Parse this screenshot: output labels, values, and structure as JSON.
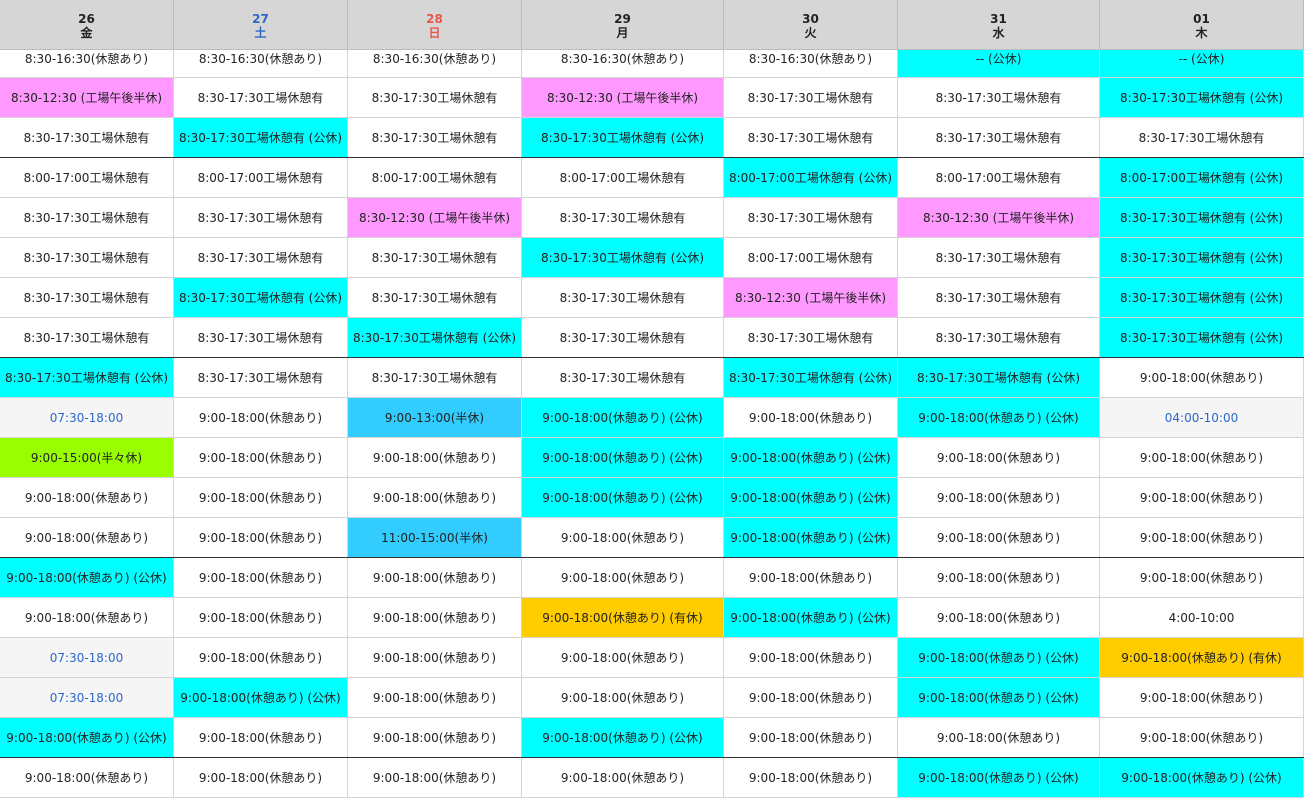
{
  "days": [
    {
      "date": "26",
      "weekday": "金",
      "type": "normal"
    },
    {
      "date": "27",
      "weekday": "土",
      "type": "sat"
    },
    {
      "date": "28",
      "weekday": "日",
      "type": "sun"
    },
    {
      "date": "29",
      "weekday": "月",
      "type": "normal"
    },
    {
      "date": "30",
      "weekday": "火",
      "type": "normal"
    },
    {
      "date": "31",
      "weekday": "水",
      "type": "normal"
    },
    {
      "date": "01",
      "weekday": "木",
      "type": "normal"
    }
  ],
  "legend_colors": {
    "w": "#ffffff",
    "c": "#00ffff",
    "p": "#ff99ff",
    "b": "#33ccff",
    "g": "#99ff00",
    "o": "#ffcc00",
    "e": "#f5f5f5"
  },
  "rows": [
    [
      [
        "8:30-16:30(休憩あり)",
        "w"
      ],
      [
        "8:30-16:30(休憩あり)",
        "w"
      ],
      [
        "8:30-16:30(休憩あり)",
        "w"
      ],
      [
        "8:30-16:30(休憩あり)",
        "w"
      ],
      [
        "8:30-16:30(休憩あり)",
        "w"
      ],
      [
        "-- (公休)",
        "c"
      ],
      [
        "-- (公休)",
        "c"
      ]
    ],
    [
      [
        "8:30-12:30 (工場午後半休)",
        "p"
      ],
      [
        "8:30-17:30工場休憩有",
        "w"
      ],
      [
        "8:30-17:30工場休憩有",
        "w"
      ],
      [
        "8:30-12:30 (工場午後半休)",
        "p"
      ],
      [
        "8:30-17:30工場休憩有",
        "w"
      ],
      [
        "8:30-17:30工場休憩有",
        "w"
      ],
      [
        "8:30-17:30工場休憩有 (公休)",
        "c"
      ]
    ],
    [
      [
        "8:30-17:30工場休憩有",
        "w"
      ],
      [
        "8:30-17:30工場休憩有 (公休)",
        "c"
      ],
      [
        "8:30-17:30工場休憩有",
        "w"
      ],
      [
        "8:30-17:30工場休憩有 (公休)",
        "c"
      ],
      [
        "8:30-17:30工場休憩有",
        "w"
      ],
      [
        "8:30-17:30工場休憩有",
        "w"
      ],
      [
        "8:30-17:30工場休憩有",
        "w"
      ]
    ],
    [
      [
        "8:00-17:00工場休憩有",
        "w"
      ],
      [
        "8:00-17:00工場休憩有",
        "w"
      ],
      [
        "8:00-17:00工場休憩有",
        "w"
      ],
      [
        "8:00-17:00工場休憩有",
        "w"
      ],
      [
        "8:00-17:00工場休憩有 (公休)",
        "c"
      ],
      [
        "8:00-17:00工場休憩有",
        "w"
      ],
      [
        "8:00-17:00工場休憩有 (公休)",
        "c"
      ]
    ],
    [
      [
        "8:30-17:30工場休憩有",
        "w"
      ],
      [
        "8:30-17:30工場休憩有",
        "w"
      ],
      [
        "8:30-12:30 (工場午後半休)",
        "p"
      ],
      [
        "8:30-17:30工場休憩有",
        "w"
      ],
      [
        "8:30-17:30工場休憩有",
        "w"
      ],
      [
        "8:30-12:30 (工場午後半休)",
        "p"
      ],
      [
        "8:30-17:30工場休憩有 (公休)",
        "c"
      ]
    ],
    [
      [
        "8:30-17:30工場休憩有",
        "w"
      ],
      [
        "8:30-17:30工場休憩有",
        "w"
      ],
      [
        "8:30-17:30工場休憩有",
        "w"
      ],
      [
        "8:30-17:30工場休憩有 (公休)",
        "c"
      ],
      [
        "8:00-17:00工場休憩有",
        "w"
      ],
      [
        "8:30-17:30工場休憩有",
        "w"
      ],
      [
        "8:30-17:30工場休憩有 (公休)",
        "c"
      ]
    ],
    [
      [
        "8:30-17:30工場休憩有",
        "w"
      ],
      [
        "8:30-17:30工場休憩有 (公休)",
        "c"
      ],
      [
        "8:30-17:30工場休憩有",
        "w"
      ],
      [
        "8:30-17:30工場休憩有",
        "w"
      ],
      [
        "8:30-12:30 (工場午後半休)",
        "p"
      ],
      [
        "8:30-17:30工場休憩有",
        "w"
      ],
      [
        "8:30-17:30工場休憩有 (公休)",
        "c"
      ]
    ],
    [
      [
        "8:30-17:30工場休憩有",
        "w"
      ],
      [
        "8:30-17:30工場休憩有",
        "w"
      ],
      [
        "8:30-17:30工場休憩有 (公休)",
        "c"
      ],
      [
        "8:30-17:30工場休憩有",
        "w"
      ],
      [
        "8:30-17:30工場休憩有",
        "w"
      ],
      [
        "8:30-17:30工場休憩有",
        "w"
      ],
      [
        "8:30-17:30工場休憩有 (公休)",
        "c"
      ]
    ],
    [
      [
        "8:30-17:30工場休憩有 (公休)",
        "c"
      ],
      [
        "8:30-17:30工場休憩有",
        "w"
      ],
      [
        "8:30-17:30工場休憩有",
        "w"
      ],
      [
        "8:30-17:30工場休憩有",
        "w"
      ],
      [
        "8:30-17:30工場休憩有 (公休)",
        "c"
      ],
      [
        "8:30-17:30工場休憩有 (公休)",
        "c"
      ],
      [
        "9:00-18:00(休憩あり)",
        "w"
      ]
    ],
    [
      [
        "07:30-18:00",
        "e"
      ],
      [
        "9:00-18:00(休憩あり)",
        "w"
      ],
      [
        "9:00-13:00(半休)",
        "b"
      ],
      [
        "9:00-18:00(休憩あり) (公休)",
        "c"
      ],
      [
        "9:00-18:00(休憩あり)",
        "w"
      ],
      [
        "9:00-18:00(休憩あり) (公休)",
        "c"
      ],
      [
        "04:00-10:00",
        "e"
      ]
    ],
    [
      [
        "9:00-15:00(半々休)",
        "g"
      ],
      [
        "9:00-18:00(休憩あり)",
        "w"
      ],
      [
        "9:00-18:00(休憩あり)",
        "w"
      ],
      [
        "9:00-18:00(休憩あり) (公休)",
        "c"
      ],
      [
        "9:00-18:00(休憩あり) (公休)",
        "c"
      ],
      [
        "9:00-18:00(休憩あり)",
        "w"
      ],
      [
        "9:00-18:00(休憩あり)",
        "w"
      ]
    ],
    [
      [
        "9:00-18:00(休憩あり)",
        "w"
      ],
      [
        "9:00-18:00(休憩あり)",
        "w"
      ],
      [
        "9:00-18:00(休憩あり)",
        "w"
      ],
      [
        "9:00-18:00(休憩あり) (公休)",
        "c"
      ],
      [
        "9:00-18:00(休憩あり) (公休)",
        "c"
      ],
      [
        "9:00-18:00(休憩あり)",
        "w"
      ],
      [
        "9:00-18:00(休憩あり)",
        "w"
      ]
    ],
    [
      [
        "9:00-18:00(休憩あり)",
        "w"
      ],
      [
        "9:00-18:00(休憩あり)",
        "w"
      ],
      [
        "11:00-15:00(半休)",
        "b"
      ],
      [
        "9:00-18:00(休憩あり)",
        "w"
      ],
      [
        "9:00-18:00(休憩あり) (公休)",
        "c"
      ],
      [
        "9:00-18:00(休憩あり)",
        "w"
      ],
      [
        "9:00-18:00(休憩あり)",
        "w"
      ]
    ],
    [
      [
        "9:00-18:00(休憩あり) (公休)",
        "c"
      ],
      [
        "9:00-18:00(休憩あり)",
        "w"
      ],
      [
        "9:00-18:00(休憩あり)",
        "w"
      ],
      [
        "9:00-18:00(休憩あり)",
        "w"
      ],
      [
        "9:00-18:00(休憩あり)",
        "w"
      ],
      [
        "9:00-18:00(休憩あり)",
        "w"
      ],
      [
        "9:00-18:00(休憩あり)",
        "w"
      ]
    ],
    [
      [
        "9:00-18:00(休憩あり)",
        "w"
      ],
      [
        "9:00-18:00(休憩あり)",
        "w"
      ],
      [
        "9:00-18:00(休憩あり)",
        "w"
      ],
      [
        "9:00-18:00(休憩あり) (有休)",
        "o"
      ],
      [
        "9:00-18:00(休憩あり) (公休)",
        "c"
      ],
      [
        "9:00-18:00(休憩あり)",
        "w"
      ],
      [
        "4:00-10:00",
        "w"
      ]
    ],
    [
      [
        "07:30-18:00",
        "e"
      ],
      [
        "9:00-18:00(休憩あり)",
        "w"
      ],
      [
        "9:00-18:00(休憩あり)",
        "w"
      ],
      [
        "9:00-18:00(休憩あり)",
        "w"
      ],
      [
        "9:00-18:00(休憩あり)",
        "w"
      ],
      [
        "9:00-18:00(休憩あり) (公休)",
        "c"
      ],
      [
        "9:00-18:00(休憩あり) (有休)",
        "o"
      ]
    ],
    [
      [
        "07:30-18:00",
        "e"
      ],
      [
        "9:00-18:00(休憩あり) (公休)",
        "c"
      ],
      [
        "9:00-18:00(休憩あり)",
        "w"
      ],
      [
        "9:00-18:00(休憩あり)",
        "w"
      ],
      [
        "9:00-18:00(休憩あり)",
        "w"
      ],
      [
        "9:00-18:00(休憩あり) (公休)",
        "c"
      ],
      [
        "9:00-18:00(休憩あり)",
        "w"
      ]
    ],
    [
      [
        "9:00-18:00(休憩あり) (公休)",
        "c"
      ],
      [
        "9:00-18:00(休憩あり)",
        "w"
      ],
      [
        "9:00-18:00(休憩あり)",
        "w"
      ],
      [
        "9:00-18:00(休憩あり) (公休)",
        "c"
      ],
      [
        "9:00-18:00(休憩あり)",
        "w"
      ],
      [
        "9:00-18:00(休憩あり)",
        "w"
      ],
      [
        "9:00-18:00(休憩あり)",
        "w"
      ]
    ],
    [
      [
        "9:00-18:00(休憩あり)",
        "w"
      ],
      [
        "9:00-18:00(休憩あり)",
        "w"
      ],
      [
        "9:00-18:00(休憩あり)",
        "w"
      ],
      [
        "9:00-18:00(休憩あり)",
        "w"
      ],
      [
        "9:00-18:00(休憩あり)",
        "w"
      ],
      [
        "9:00-18:00(休憩あり) (公休)",
        "c"
      ],
      [
        "9:00-18:00(休憩あり) (公休)",
        "c"
      ]
    ]
  ]
}
